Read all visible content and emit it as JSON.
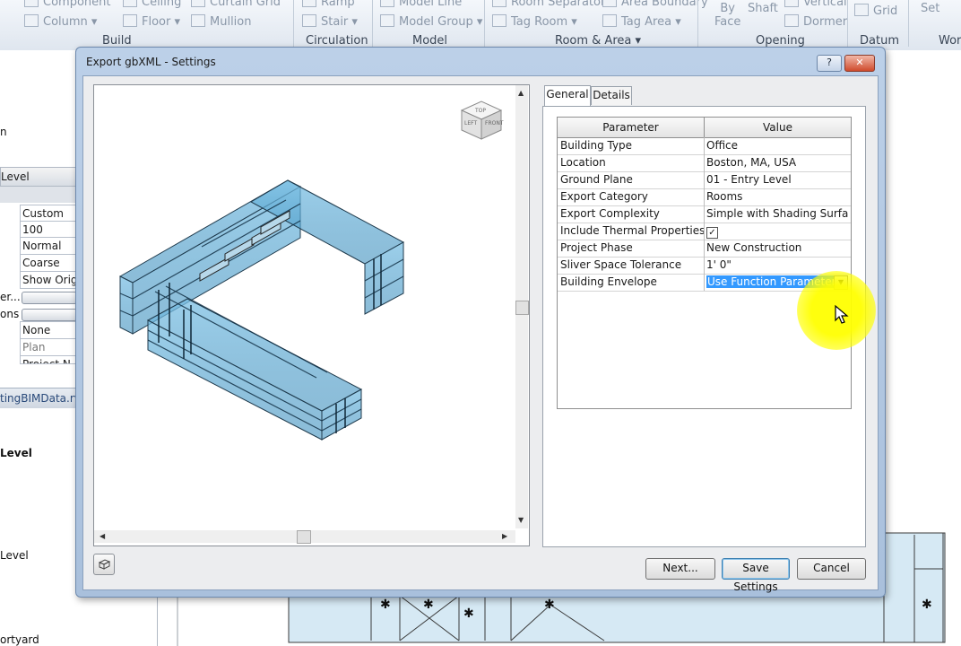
{
  "ribbon": {
    "row1": [
      "Component",
      "Ceiling",
      "Curtain Grid",
      "Model Line",
      "Room Separator",
      "Area Boundary",
      "Vertical"
    ],
    "row2": [
      {
        "label": "Column",
        "dropdown": true
      },
      {
        "label": "Floor",
        "dropdown": true
      },
      {
        "label": "Mullion",
        "dropdown": false
      },
      {
        "label": "Stair",
        "dropdown": true
      },
      {
        "label": "Model Group",
        "dropdown": true
      },
      {
        "label": "Tag Room",
        "dropdown": true
      },
      {
        "label": "Tag Area",
        "dropdown": true
      },
      {
        "label": "Dormer",
        "dropdown": false
      },
      {
        "label": "Grid",
        "dropdown": false
      }
    ],
    "ramp": "Ramp",
    "by_face": [
      "By",
      "Face"
    ],
    "shaft": "Shaft",
    "set": "Set",
    "groups": [
      "Build",
      "Circulation",
      "Model",
      "Room & Area",
      "Opening",
      "Datum",
      "Wor"
    ],
    "room_area_dropdown": "▾"
  },
  "left_panel": {
    "label_n": "n",
    "level_header": "Level",
    "values": [
      "Custom",
      "100",
      "Normal",
      "Coarse",
      "Show Orig",
      "None",
      "Plan",
      "Project N"
    ],
    "prop_labels": [
      "er...",
      "ons"
    ],
    "file_name": "tingBIMData.rvt",
    "tree_level_bold": "Level",
    "tree_level": "Level",
    "tree_courtyard": "ortyard"
  },
  "dialog": {
    "title": "Export gbXML - Settings",
    "help_label": "?",
    "close_label": "✕",
    "tabs": [
      "General",
      "Details"
    ],
    "table": {
      "headers": [
        "Parameter",
        "Value"
      ],
      "rows": [
        {
          "param": "Building Type",
          "value": "Office"
        },
        {
          "param": "Location",
          "value": "Boston, MA, USA"
        },
        {
          "param": "Ground Plane",
          "value": "01 - Entry Level"
        },
        {
          "param": "Export Category",
          "value": "Rooms"
        },
        {
          "param": "Export Complexity",
          "value": "Simple with Shading Surfa"
        },
        {
          "param": "Include Thermal Properties",
          "value": "✓"
        },
        {
          "param": "Project Phase",
          "value": "New Construction"
        },
        {
          "param": "Sliver Space Tolerance",
          "value": "1'  0\""
        },
        {
          "param": "Building Envelope",
          "value": "Use Function Parameter"
        }
      ]
    },
    "buttons": {
      "next": "Next...",
      "save": "Save Settings",
      "cancel": "Cancel"
    },
    "viewcube_labels": [
      "TOP",
      "LEFT",
      "FRONT"
    ],
    "colors": {
      "accent": "#3399ff",
      "highlight": "#ffff00",
      "building_fill": "#5aa6cf"
    }
  }
}
